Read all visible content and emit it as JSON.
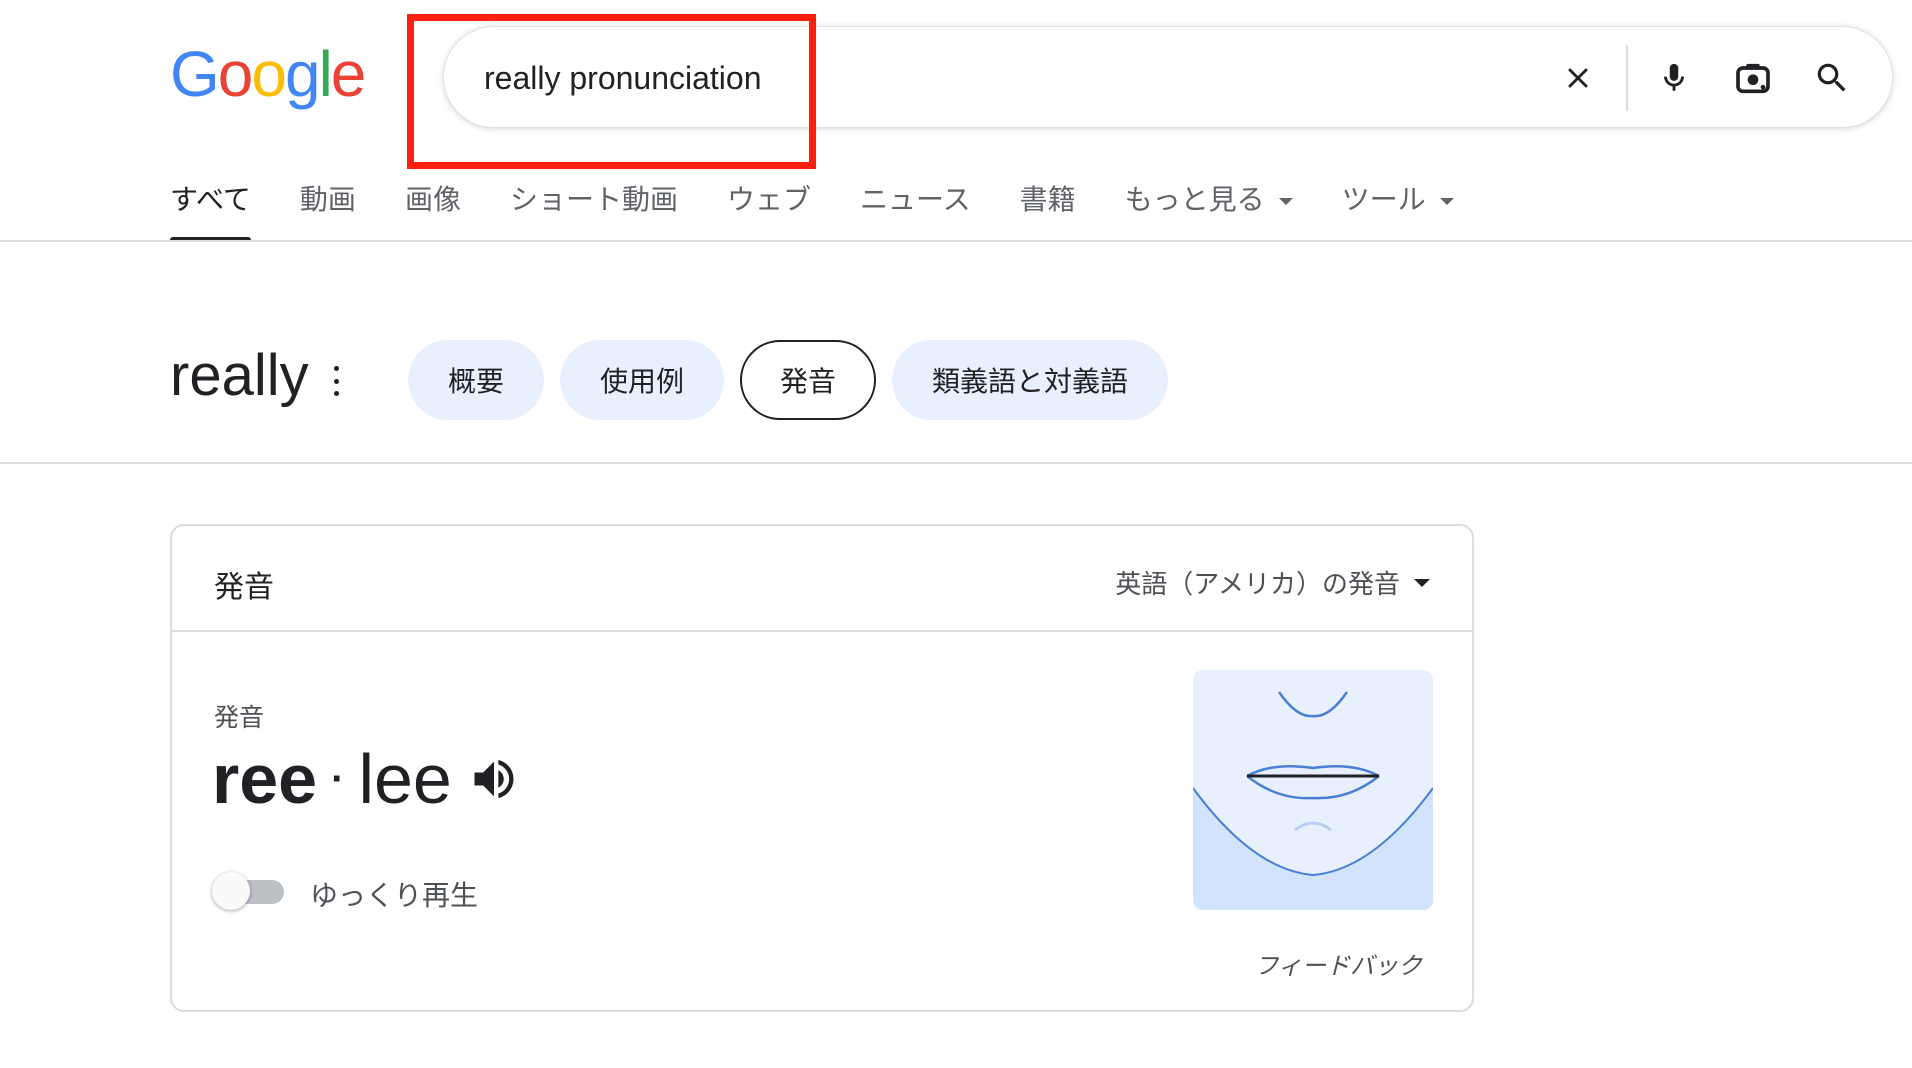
{
  "logo": {
    "letters": [
      "G",
      "o",
      "o",
      "g",
      "l",
      "e"
    ],
    "colors": [
      "#4285F4",
      "#EA4335",
      "#FBBC05",
      "#4285F4",
      "#34A853",
      "#EA4335"
    ]
  },
  "search": {
    "query": "really pronunciation",
    "clear_icon": "close-icon",
    "mic_icon": "microphone-icon",
    "lens_icon": "camera-lens-icon",
    "search_icon": "search-icon"
  },
  "highlight_color": "#ff1f0f",
  "tabs": [
    {
      "label": "すべて",
      "active": true
    },
    {
      "label": "動画"
    },
    {
      "label": "画像"
    },
    {
      "label": "ショート動画"
    },
    {
      "label": "ウェブ"
    },
    {
      "label": "ニュース"
    },
    {
      "label": "書籍"
    },
    {
      "label": "もっと見る",
      "dropdown": true
    },
    {
      "label": "ツール",
      "dropdown": true
    }
  ],
  "word": {
    "title": "really",
    "chips": [
      {
        "label": "概要"
      },
      {
        "label": "使用例"
      },
      {
        "label": "発音",
        "active": true
      },
      {
        "label": "類義語と対義語"
      }
    ]
  },
  "card": {
    "title": "発音",
    "dialect": "英語（アメリカ）の発音",
    "pron_label": "発音",
    "syllables": [
      "ree",
      "lee"
    ],
    "separator": "·",
    "slow_label": "ゆっくり再生",
    "slow_enabled": false,
    "feedback": "フィードバック"
  }
}
